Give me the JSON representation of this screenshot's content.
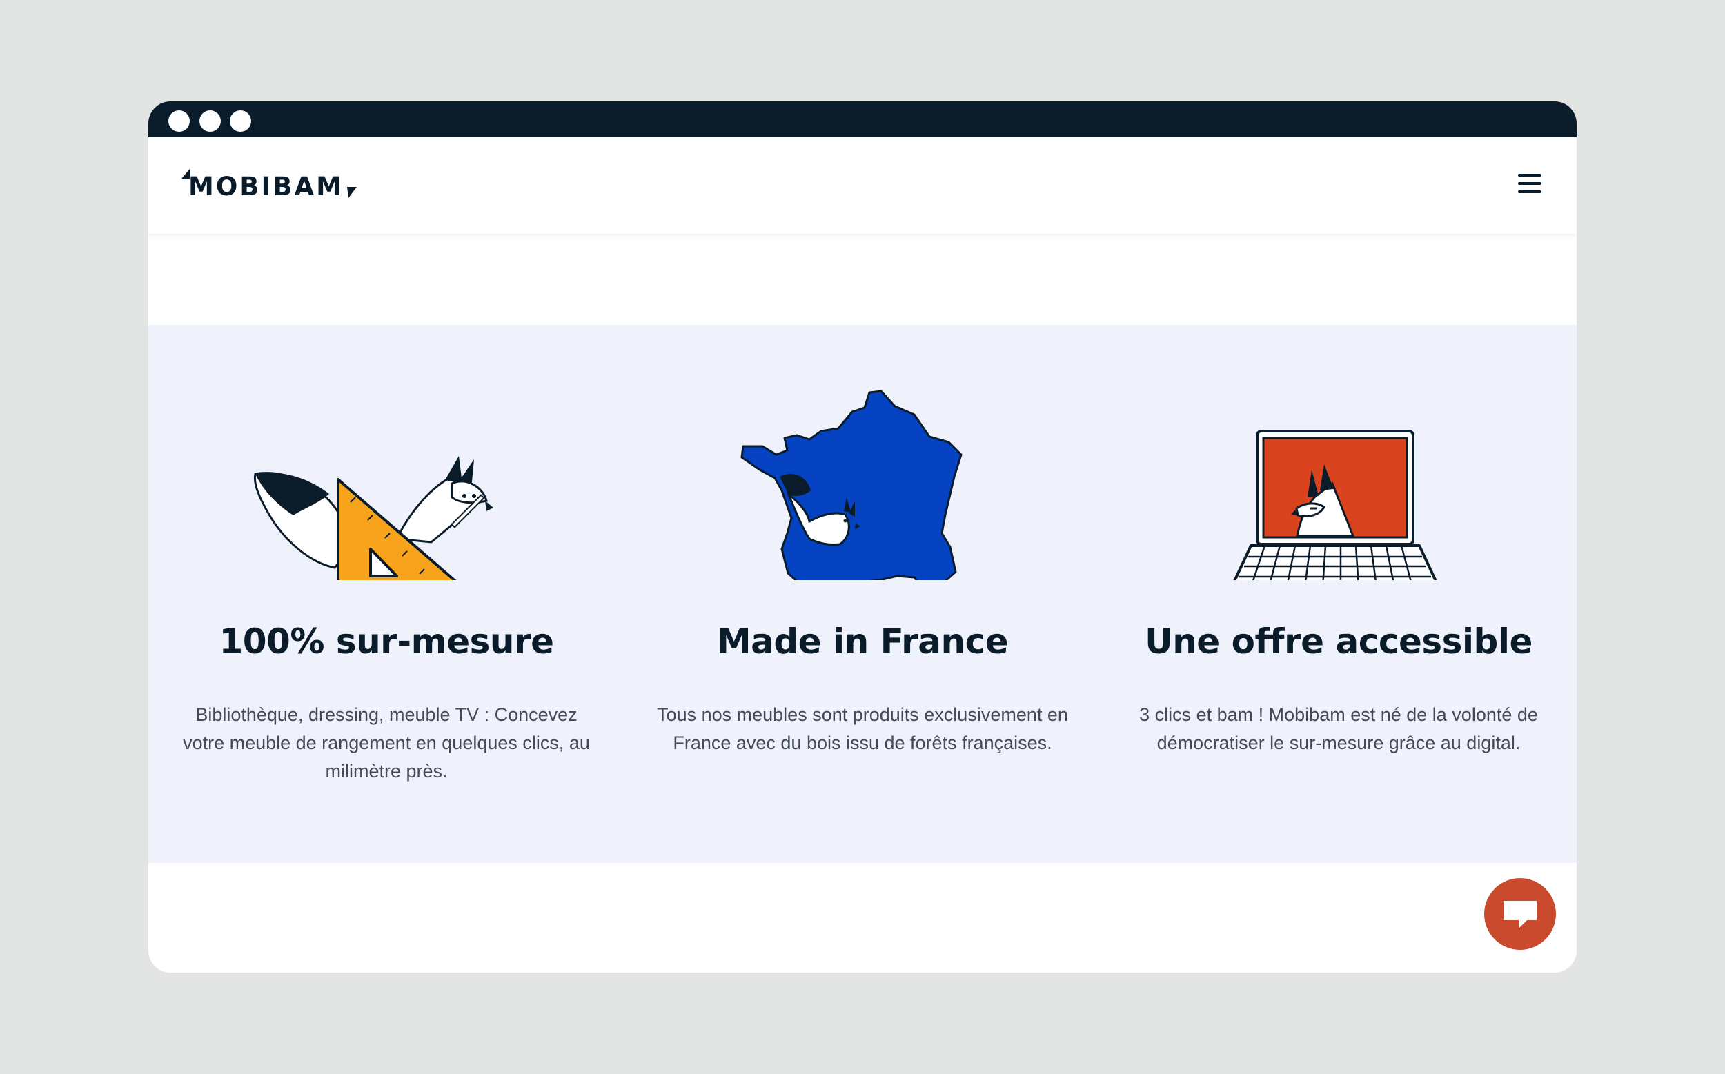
{
  "brand": {
    "name": "MOBIBAM"
  },
  "features": [
    {
      "title": "100% sur-mesure",
      "description": "Bibliothèque, dressing, meuble TV : Concevez votre meuble de rangement en quelques clics, au milimètre près.",
      "icon": "set-square-squirrel-icon"
    },
    {
      "title": "Made in France",
      "description": "Tous nos meubles sont produits exclusivement en France avec du bois issu de forêts françaises.",
      "icon": "france-map-squirrel-icon"
    },
    {
      "title": "Une offre accessible",
      "description": "3 clics et bam ! Mobibam est né de la volonté de démocratiser le sur-mesure grâce au digital.",
      "icon": "laptop-squirrel-icon"
    }
  ],
  "colors": {
    "background": "#e3e4e4",
    "titlebar": "#0a1b2a",
    "features_bg": "#eff2fa",
    "accent_orange": "#f7a41c",
    "accent_blue": "#0543c2",
    "accent_red": "#d9441f",
    "chat_button": "#c94a2c",
    "text_dark": "#0a1b2a",
    "text_body": "#444b54"
  }
}
